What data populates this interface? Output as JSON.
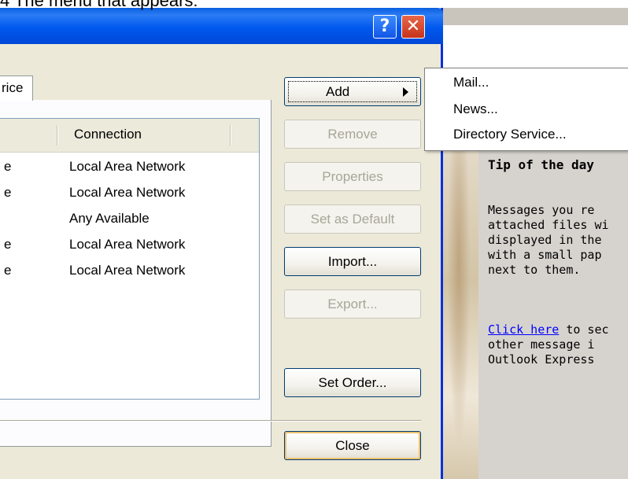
{
  "caption": "4 The menu that appears:",
  "titlebar": {
    "help_label": "?",
    "close_label": "✕"
  },
  "tab": {
    "label": "rice"
  },
  "list": {
    "columns": [
      "",
      "Connection"
    ],
    "rows": [
      {
        "c1": "e",
        "c2": "Local Area Network"
      },
      {
        "c1": "e",
        "c2": "Local Area Network"
      },
      {
        "c1": "",
        "c2": "Any Available"
      },
      {
        "c1": "e",
        "c2": "Local Area Network"
      },
      {
        "c1": "e",
        "c2": "Local Area Network"
      }
    ]
  },
  "buttons": {
    "add": "Add",
    "remove": "Remove",
    "properties": "Properties",
    "set_default": "Set as Default",
    "import": "Import...",
    "export": "Export...",
    "set_order": "Set Order...",
    "close": "Close"
  },
  "menu": {
    "items": [
      "Mail...",
      "News...",
      "Directory Service..."
    ]
  },
  "tip": {
    "title": "Tip of the day",
    "body_lines": [
      "Messages you re",
      "attached files wi",
      "displayed in the",
      "with a small pap",
      "next to them."
    ],
    "link_text": "Click here",
    "link_tail": " to sec",
    "tail_lines": [
      "other message i",
      "Outlook Express"
    ]
  }
}
